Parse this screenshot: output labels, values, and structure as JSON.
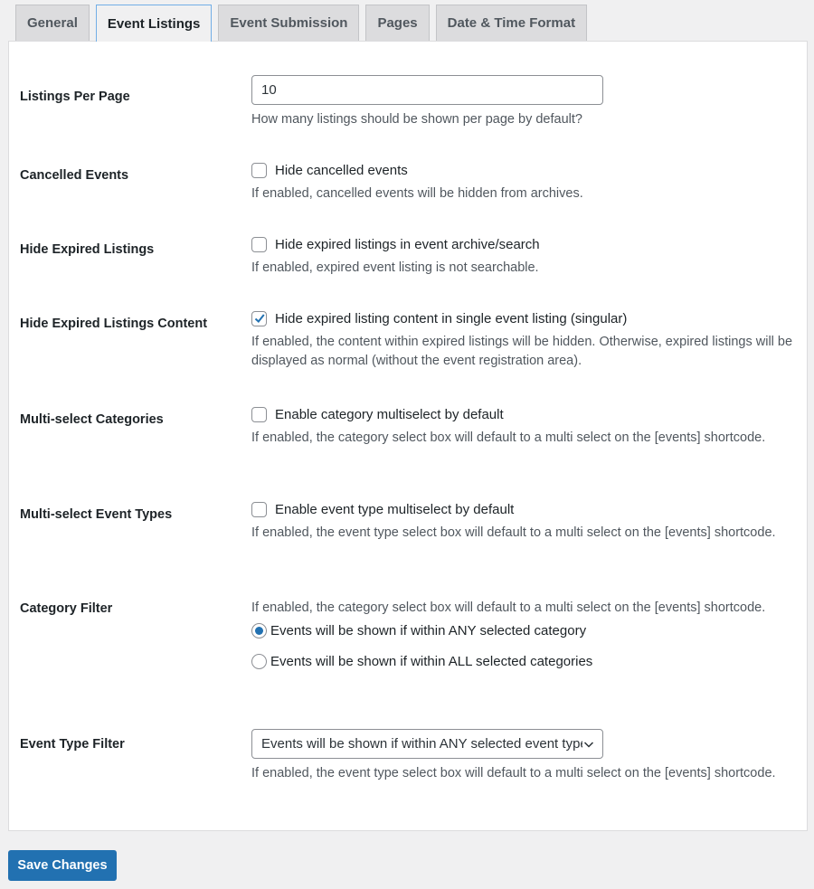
{
  "tabs": [
    {
      "label": "General",
      "active": false
    },
    {
      "label": "Event Listings",
      "active": true
    },
    {
      "label": "Event Submission",
      "active": false
    },
    {
      "label": "Pages",
      "active": false
    },
    {
      "label": "Date & Time Format",
      "active": false
    }
  ],
  "settings": {
    "listings_per_page": {
      "label": "Listings Per Page",
      "value": "10",
      "description": "How many listings should be shown per page by default?"
    },
    "cancelled_events": {
      "label": "Cancelled Events",
      "checkbox_label": "Hide cancelled events",
      "checked": false,
      "description": "If enabled, cancelled events will be hidden from archives."
    },
    "hide_expired": {
      "label": "Hide Expired Listings",
      "checkbox_label": "Hide expired listings in event archive/search",
      "checked": false,
      "description": "If enabled, expired event listing is not searchable."
    },
    "hide_expired_content": {
      "label": "Hide Expired Listings Content",
      "checkbox_label": "Hide expired listing content in single event listing (singular)",
      "checked": true,
      "description": "If enabled, the content within expired listings will be hidden. Otherwise, expired listings will be displayed as normal (without the event registration area)."
    },
    "multiselect_categories": {
      "label": "Multi-select Categories",
      "checkbox_label": "Enable category multiselect by default",
      "checked": false,
      "description": "If enabled, the category select box will default to a multi select on the [events] shortcode."
    },
    "multiselect_event_types": {
      "label": "Multi-select Event Types",
      "checkbox_label": "Enable event type multiselect by default",
      "checked": false,
      "description": "If enabled, the event type select box will default to a multi select on the [events] shortcode."
    },
    "category_filter": {
      "label": "Category Filter",
      "description": "If enabled, the category select box will default to a multi select on the [events] shortcode.",
      "options": [
        {
          "label": "Events will be shown if within ANY selected category",
          "selected": true
        },
        {
          "label": "Events will be shown if within ALL selected categories",
          "selected": false
        }
      ]
    },
    "event_type_filter": {
      "label": "Event Type Filter",
      "selected_value": "Events will be shown if within ANY selected event type",
      "description": "If enabled, the event type select box will default to a multi select on the [events] shortcode."
    }
  },
  "save_button": "Save Changes",
  "colors": {
    "accent": "#2271b1",
    "active_tab_border": "#72aee6"
  }
}
